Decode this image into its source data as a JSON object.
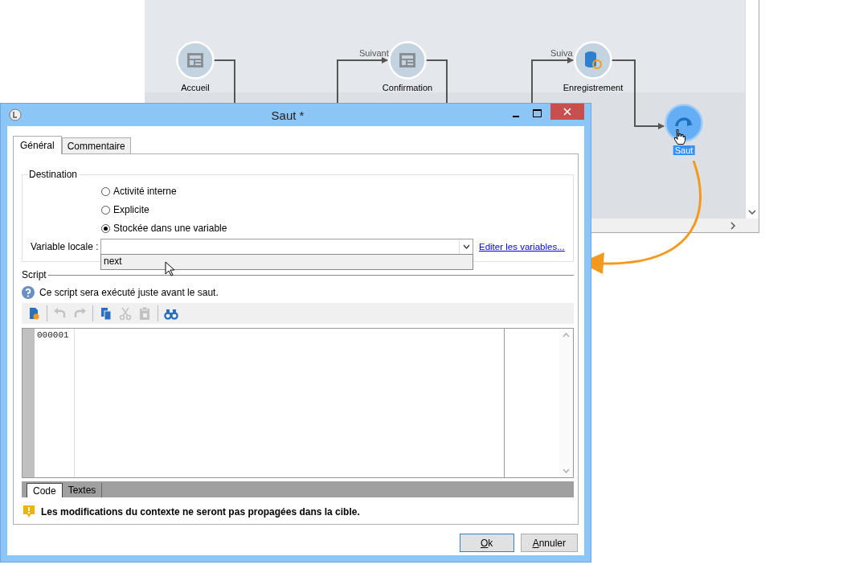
{
  "canvas": {
    "nodes": [
      {
        "label": "Accueil",
        "kind": "form",
        "selected": false
      },
      {
        "label": "Confirmation",
        "kind": "form",
        "selected": false
      },
      {
        "label": "Enregistrement",
        "kind": "database",
        "selected": false
      },
      {
        "label": "Saut",
        "kind": "jump",
        "selected": true
      }
    ],
    "edge_labels": [
      "Suivant",
      "Suiva"
    ]
  },
  "dialog": {
    "title": "Saut *",
    "tabs": [
      {
        "label": "Général",
        "selected": true
      },
      {
        "label": "Commentaire",
        "selected": false
      }
    ],
    "destination": {
      "legend": "Destination",
      "options": [
        {
          "label": "Activité interne",
          "selected": false
        },
        {
          "label": "Explicite",
          "selected": false
        },
        {
          "label": "Stockée dans une variable",
          "selected": true
        }
      ],
      "variable_label": "Variable locale :",
      "dropdown_items": [
        "next"
      ],
      "link": "Editer les variables..."
    },
    "script": {
      "legend": "Script",
      "info": "Ce script sera exécuté juste avant le saut.",
      "toolbar": [
        {
          "kind": "new",
          "disabled": false
        },
        {
          "kind": "sep"
        },
        {
          "kind": "undo",
          "disabled": true
        },
        {
          "kind": "redo",
          "disabled": true
        },
        {
          "kind": "sep"
        },
        {
          "kind": "copy",
          "disabled": false
        },
        {
          "kind": "cut",
          "disabled": true
        },
        {
          "kind": "paste",
          "disabled": true
        },
        {
          "kind": "sep"
        },
        {
          "kind": "find",
          "disabled": false
        }
      ],
      "line_numbers": [
        "000001"
      ],
      "editor_tabs": [
        {
          "label": "Code",
          "selected": true
        },
        {
          "label": "Textes",
          "selected": false
        }
      ],
      "warning": "Les modifications du contexte ne seront pas propagées dans la cible."
    },
    "buttons": [
      {
        "label": "Ok",
        "default": true
      },
      {
        "label": "Annuler",
        "default": false
      }
    ]
  }
}
